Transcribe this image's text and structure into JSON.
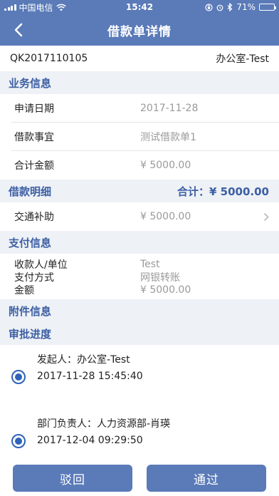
{
  "status_bar": {
    "carrier": "中国电信",
    "time": "15:42",
    "battery": "71%",
    "battery_level": 0.71
  },
  "nav": {
    "title": "借款单详情"
  },
  "doc": {
    "number": "QK2017110105",
    "department": "办公室-Test"
  },
  "business": {
    "title": "业务信息",
    "rows": [
      {
        "label": "申请日期",
        "value": "2017-11-28"
      },
      {
        "label": "借款事宜",
        "value": "测试借款单1"
      },
      {
        "label": "合计金额",
        "value": "¥ 5000.00"
      }
    ]
  },
  "loan_detail": {
    "title": "借款明细",
    "total": "合计：¥ 5000.00",
    "item": {
      "label": "交通补助",
      "value": "¥ 5000.00"
    }
  },
  "payment": {
    "title": "支付信息",
    "rows": [
      {
        "label": "收款人/单位",
        "value": "Test"
      },
      {
        "label": "支付方式",
        "value": "网银转账"
      },
      {
        "label": "金额",
        "value": "¥ 5000.00"
      }
    ]
  },
  "attachments": {
    "title": "附件信息"
  },
  "approval": {
    "title": "审批进度",
    "steps": [
      {
        "who": "发起人：办公室-Test",
        "when": "2017-11-28 15:45:40"
      },
      {
        "who": "部门负责人：人力资源部-肖瑛",
        "when": "2017-12-04 09:29:50"
      }
    ]
  },
  "actions": {
    "reject": "驳回",
    "approve": "通过"
  },
  "colors": {
    "primary": "#5a7ab8",
    "section_text": "#3c5fa3",
    "section_bg": "#eef1f6",
    "radio": "#2f62b8"
  }
}
